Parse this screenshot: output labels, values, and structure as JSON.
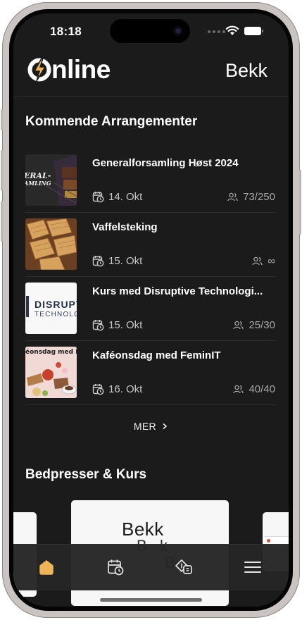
{
  "status_bar": {
    "time": "18:18"
  },
  "header": {
    "logo_text": "nline",
    "company": "Bekk"
  },
  "upcoming": {
    "title": "Kommende Arrangementer",
    "events": [
      {
        "title": "Generalforsamling Høst 2024",
        "date": "14. Okt",
        "capacity": "73/250",
        "thumb_text_1": "ERAL-",
        "thumb_text_2": "AMLING"
      },
      {
        "title": "Vaffelsteking",
        "date": "15. Okt",
        "capacity": "∞"
      },
      {
        "title": "Kurs med Disruptive Technologi...",
        "date": "15. Okt",
        "capacity": "25/30",
        "thumb_text_1": "DISRUPT",
        "thumb_text_2": "TECHNOLO"
      },
      {
        "title": "Kaféonsdag med FeminIT",
        "date": "16. Okt",
        "capacity": "40/40",
        "thumb_text_1": "éonsdag med Femi"
      }
    ],
    "more_label": "MER",
    "more_icon": "chevron-right-icon"
  },
  "companies": {
    "title": "Bedpresser & Kurs",
    "card_logo": "Bekk",
    "card_logo_echo_1": "B   k",
    "card_logo_echo_2": "B"
  },
  "tabbar": {
    "items": [
      {
        "name": "home-icon",
        "active": true
      },
      {
        "name": "calendar-icon",
        "active": false
      },
      {
        "name": "career-icon",
        "active": false
      },
      {
        "name": "menu-icon",
        "active": false
      }
    ]
  },
  "colors": {
    "accent": "#f0b458",
    "background": "#1b1b1b",
    "text": "#ffffff"
  }
}
